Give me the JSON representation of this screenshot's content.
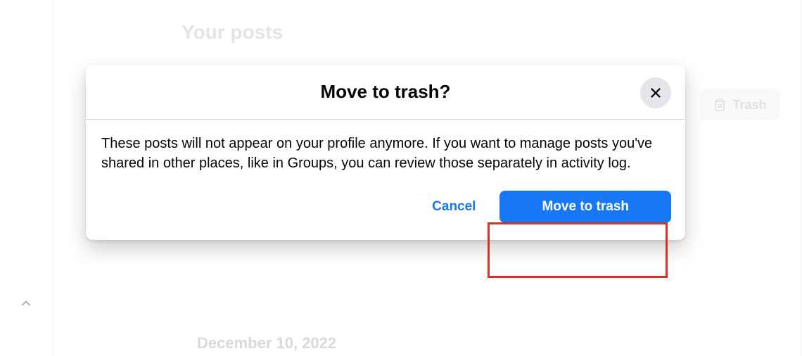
{
  "page": {
    "title": "Your posts",
    "date_heading": "December 10, 2022",
    "trash_button_label": "Trash"
  },
  "modal": {
    "title": "Move to trash?",
    "body_text": "These posts will not appear on your profile anymore. If you want to manage posts you've shared in other places, like in Groups, you can review those separately in activity log.",
    "cancel_label": "Cancel",
    "confirm_label": "Move to trash"
  }
}
